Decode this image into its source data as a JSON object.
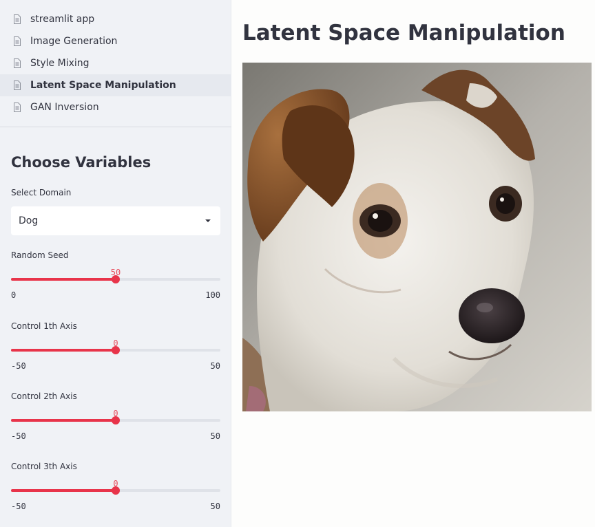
{
  "nav": {
    "items": [
      {
        "label": "streamlit app",
        "active": false
      },
      {
        "label": "Image Generation",
        "active": false
      },
      {
        "label": "Style Mixing",
        "active": false
      },
      {
        "label": "Latent Space Manipulation",
        "active": true
      },
      {
        "label": "GAN Inversion",
        "active": false
      }
    ]
  },
  "sidebar": {
    "title": "Choose Variables",
    "domain_select": {
      "label": "Select Domain",
      "value": "Dog"
    },
    "sliders": [
      {
        "label": "Random Seed",
        "value": "50",
        "min": "0",
        "max": "100",
        "fraction": 0.5
      },
      {
        "label": "Control 1th Axis",
        "value": "0",
        "min": "-50",
        "max": "50",
        "fraction": 0.5
      },
      {
        "label": "Control 2th Axis",
        "value": "0",
        "min": "-50",
        "max": "50",
        "fraction": 0.5
      },
      {
        "label": "Control 3th Axis",
        "value": "0",
        "min": "-50",
        "max": "50",
        "fraction": 0.5
      }
    ]
  },
  "main": {
    "title": "Latent Space Manipulation",
    "image_subject": "dog-portrait"
  },
  "colors": {
    "accent": "#e8344a",
    "sidebar_bg": "#f0f2f6",
    "text": "#31333f"
  }
}
